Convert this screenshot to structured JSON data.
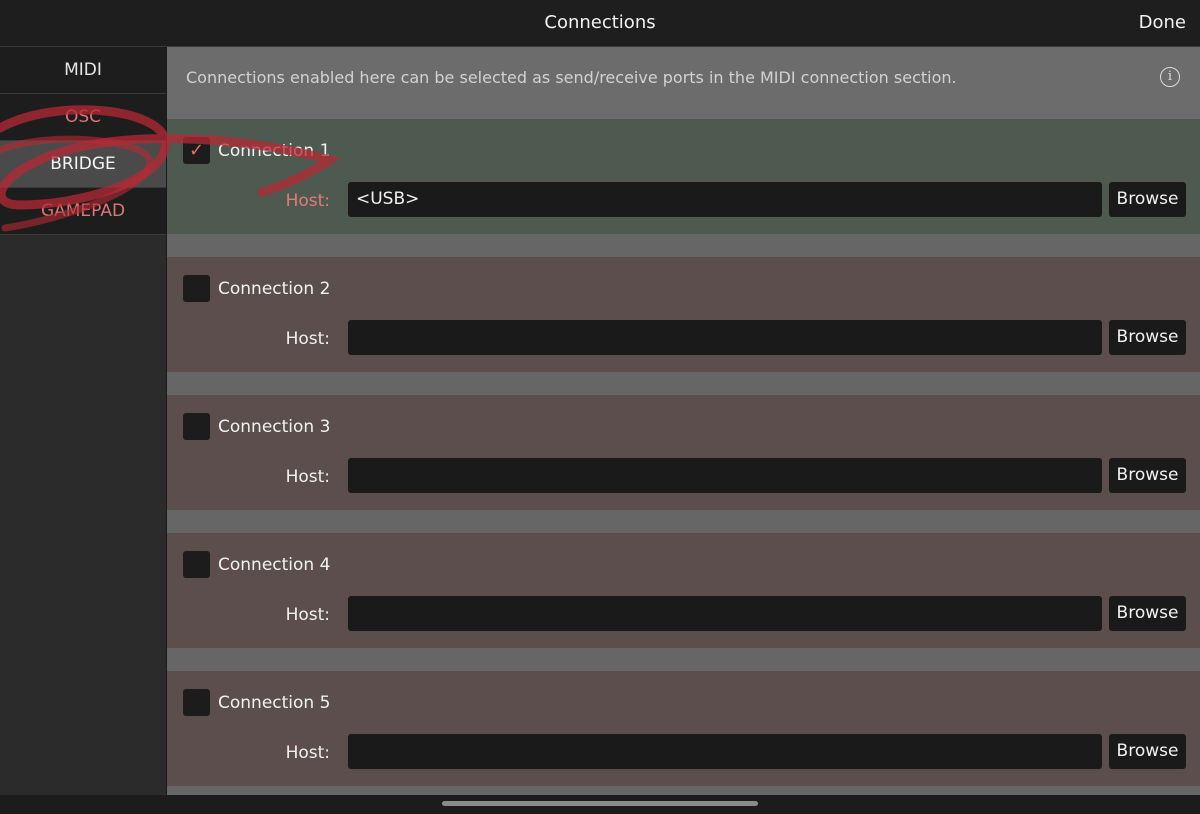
{
  "header": {
    "title": "Connections",
    "done_label": "Done"
  },
  "sidebar": {
    "items": [
      {
        "label": "MIDI",
        "color": "#e6e6e6",
        "selected": false
      },
      {
        "label": "OSC",
        "color": "#e07575",
        "selected": false
      },
      {
        "label": "BRIDGE",
        "color": "#f5f5f5",
        "selected": true
      },
      {
        "label": "GAMEPAD",
        "color": "#e07575",
        "selected": false
      }
    ]
  },
  "info": {
    "text": "Connections enabled here can be selected as send/receive ports in the MIDI connection section.",
    "icon": "info-icon"
  },
  "connections": [
    {
      "name": "Connection 1",
      "enabled": true,
      "check_glyph": "✓",
      "host_label": "Host:",
      "host_value": "<USB>",
      "browse_label": "Browse"
    },
    {
      "name": "Connection 2",
      "enabled": false,
      "check_glyph": "",
      "host_label": "Host:",
      "host_value": "",
      "browse_label": "Browse"
    },
    {
      "name": "Connection 3",
      "enabled": false,
      "check_glyph": "",
      "host_label": "Host:",
      "host_value": "",
      "browse_label": "Browse"
    },
    {
      "name": "Connection 4",
      "enabled": false,
      "check_glyph": "",
      "host_label": "Host:",
      "host_value": "",
      "browse_label": "Browse"
    },
    {
      "name": "Connection 5",
      "enabled": false,
      "check_glyph": "",
      "host_label": "Host:",
      "host_value": "",
      "browse_label": "Browse"
    }
  ],
  "colors": {
    "enabled_row": "#4e5a4f",
    "disabled_row": "#5b4e4d",
    "accent_red": "#e07575",
    "annotation_scribble": "#b52a35"
  }
}
